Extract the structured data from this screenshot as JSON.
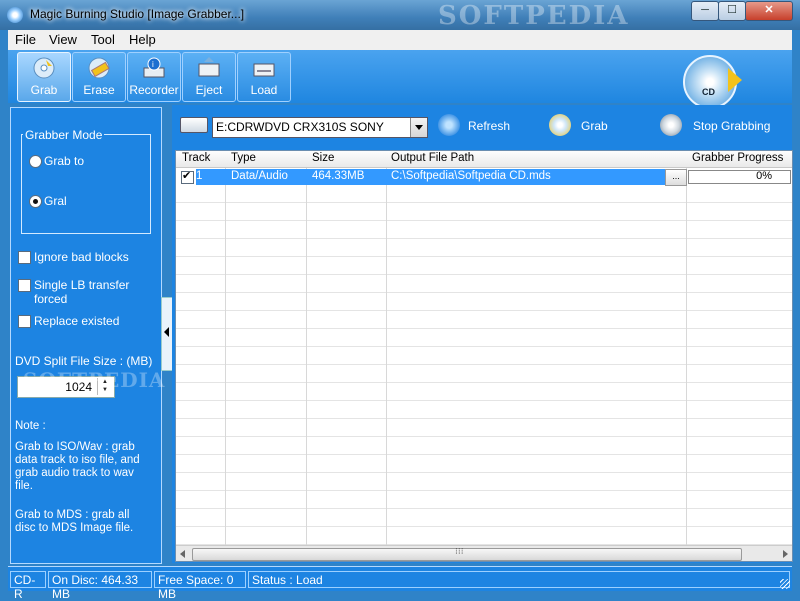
{
  "window": {
    "title": "Magic Burning Studio [Image Grabber...]",
    "minimize": "─",
    "maximize": "☐",
    "close": "✕",
    "watermark": "SOFTPEDIA"
  },
  "menu": [
    "File",
    "View",
    "Tool",
    "Help"
  ],
  "toolbar": {
    "buttons": [
      {
        "label": "Grab",
        "icon": "grab-disc-icon"
      },
      {
        "label": "Erase",
        "icon": "erase-disc-icon"
      },
      {
        "label": "Recorder",
        "icon": "recorder-info-icon"
      },
      {
        "label": "Eject",
        "icon": "eject-drive-icon"
      },
      {
        "label": "Load",
        "icon": "load-drive-icon"
      }
    ],
    "logo_text": "CD"
  },
  "left_panel": {
    "group_title": "Grabber Mode",
    "radio_grab_to": "Grab to",
    "radio_gral": "Gral",
    "checkboxes": [
      "Ignore bad blocks",
      "Single LB transfer forced",
      "Replace existed"
    ],
    "split_label": "DVD Split File Size : (MB)",
    "split_value": "1024",
    "watermark": "SOFTPEDIA",
    "note_title": "Note :",
    "note_1": "Grab to ISO/Wav : grab data track to iso file, and grab audio track to wav file.",
    "note_2": "Grab to MDS : grab all disc to MDS Image file."
  },
  "drive": {
    "selected": "E:CDRWDVD CRX310S SONY",
    "refresh": "Refresh",
    "grab": "Grab",
    "stop": "Stop Grabbing"
  },
  "table": {
    "headers": [
      "Track",
      "Type",
      "Size",
      "Output File Path",
      "Grabber Progress"
    ],
    "rows": [
      {
        "track": "1",
        "type": "Data/Audio",
        "size": "464.33MB",
        "path": "C:\\Softpedia\\Softpedia CD.mds",
        "browse": "...",
        "progress_text": "0%",
        "progress": 0
      }
    ]
  },
  "status": {
    "disc": "CD-R",
    "on_disc": "On Disc: 464.33 MB",
    "free": "Free Space: 0 MB",
    "status": "Status : Load"
  }
}
